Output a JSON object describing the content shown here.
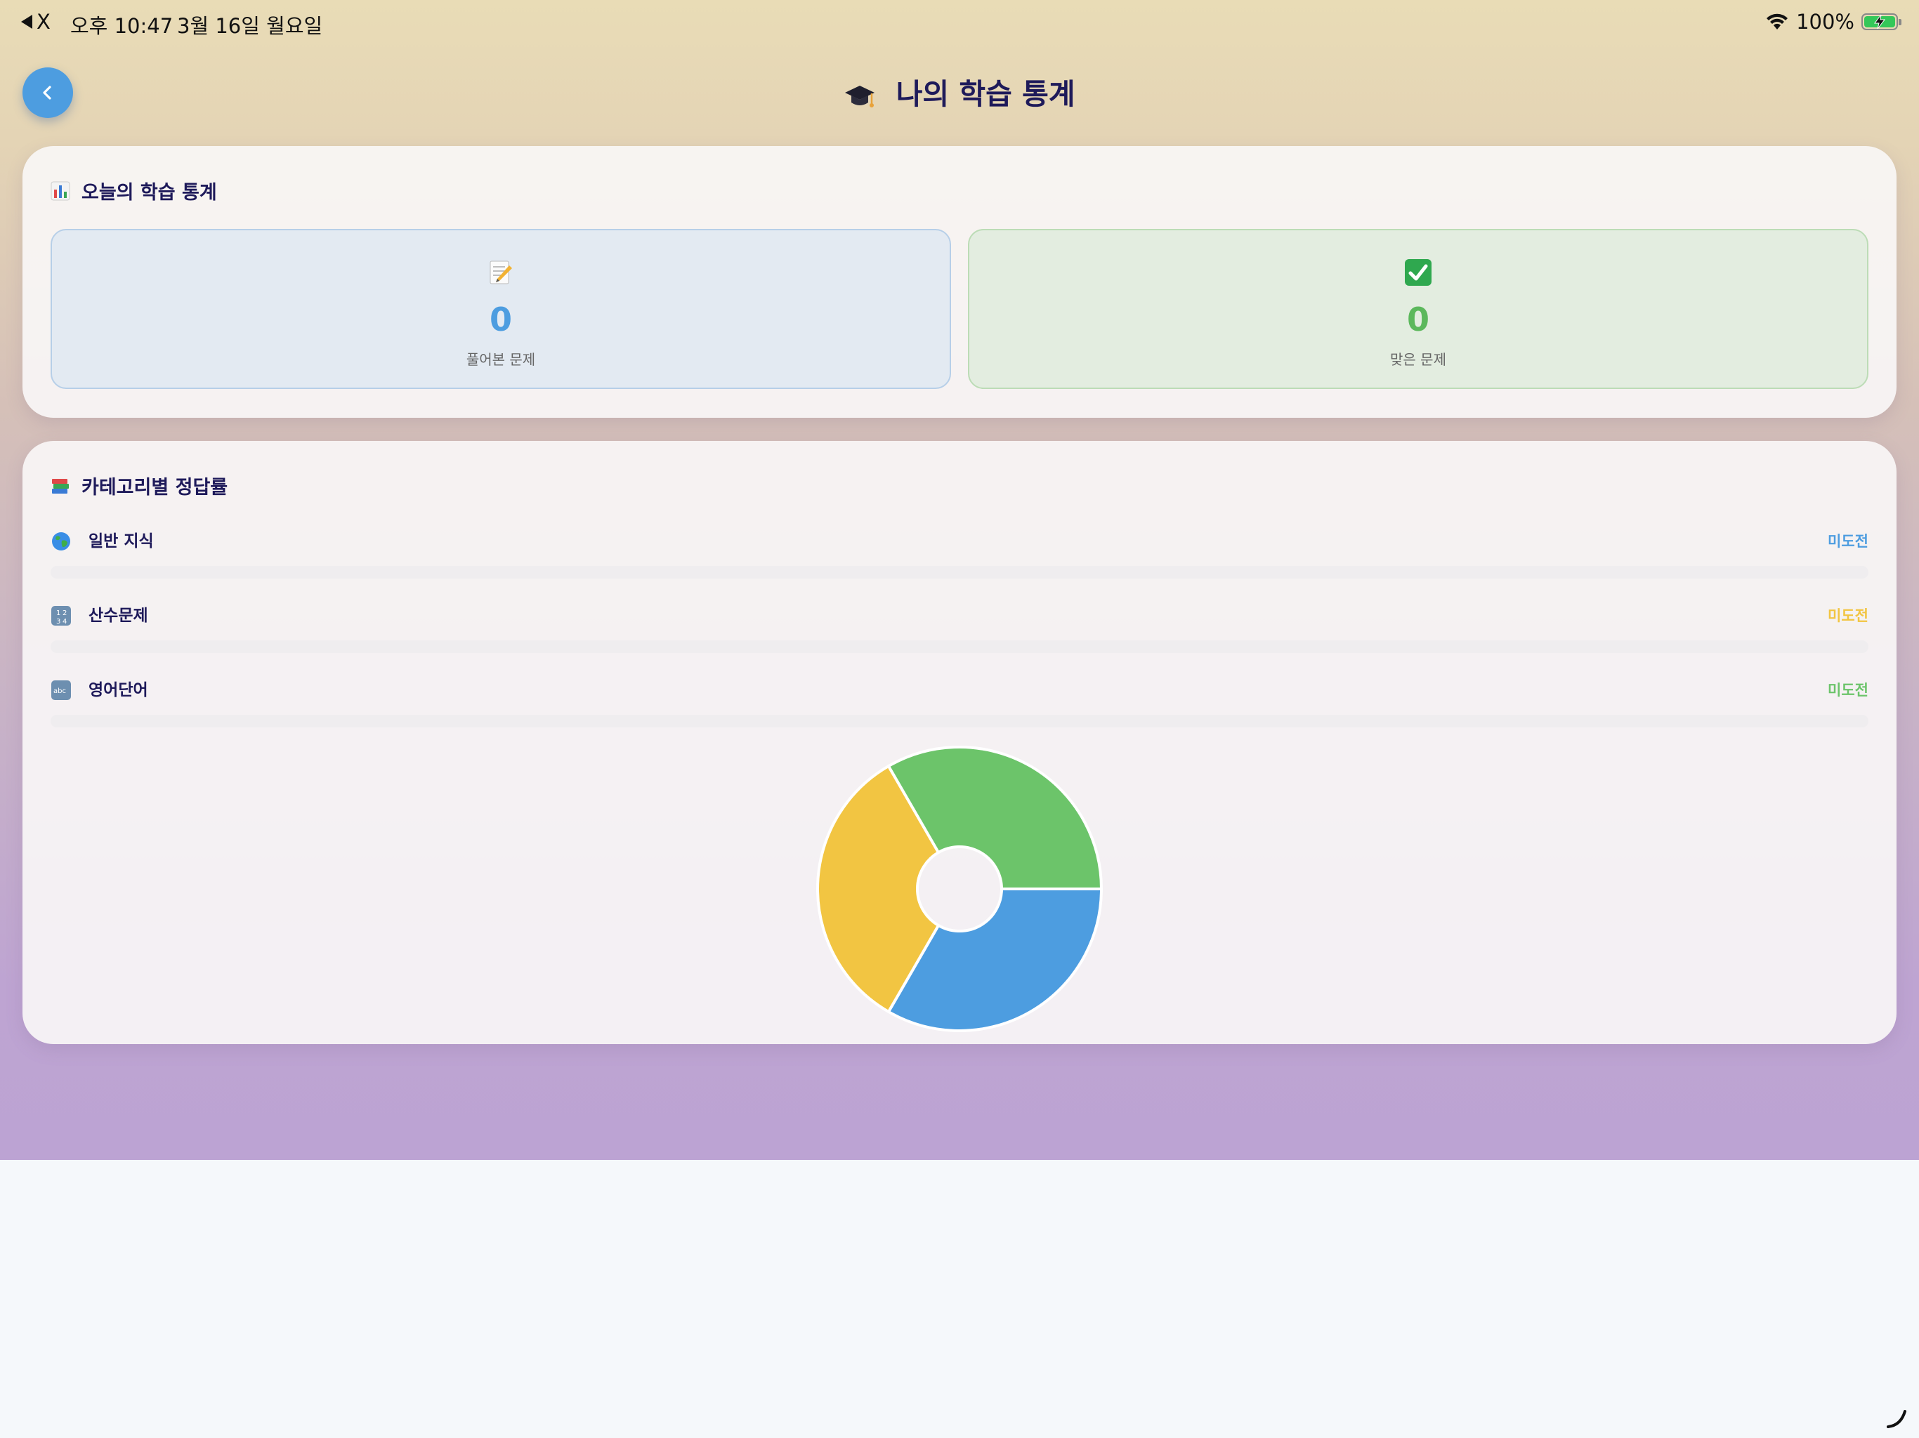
{
  "status_bar": {
    "back_app": "X",
    "time": "오후 10:47",
    "date": "3월 16일 월요일",
    "battery_percent": "100%",
    "battery_level": 1.0,
    "charging": true
  },
  "header": {
    "title": "나의 학습 통계",
    "title_icon": "graduation-cap-icon",
    "back_icon": "chevron-left-icon"
  },
  "today_card": {
    "heading": "오늘의 학습 통계",
    "heading_icon": "bar-chart-icon",
    "stats": [
      {
        "icon": "memo-pencil-icon",
        "value": "0",
        "label": "풀어본 문제",
        "color": "#4d9de0"
      },
      {
        "icon": "check-mark-icon",
        "value": "0",
        "label": "맞은 문제",
        "color": "#5cb85c"
      }
    ]
  },
  "category_card": {
    "heading": "카테고리별 정답률",
    "heading_icon": "books-icon",
    "categories": [
      {
        "name": "일반 지식",
        "icon": "globe-icon",
        "status": "미도전",
        "color": "#4d9de0",
        "progress": 0
      },
      {
        "name": "산수문제",
        "icon": "numbers-icon",
        "status": "미도전",
        "color": "#f2c542",
        "progress": 0
      },
      {
        "name": "영어단어",
        "icon": "abc-icon",
        "status": "미도전",
        "color": "#6cc46a",
        "progress": 0
      }
    ]
  },
  "chart_data": {
    "type": "pie",
    "variant": "donut",
    "categories": [
      "일반 지식",
      "산수문제",
      "영어단어"
    ],
    "values": [
      1,
      1,
      1
    ],
    "colors": [
      "#4d9de0",
      "#f2c542",
      "#6cc46a"
    ]
  }
}
